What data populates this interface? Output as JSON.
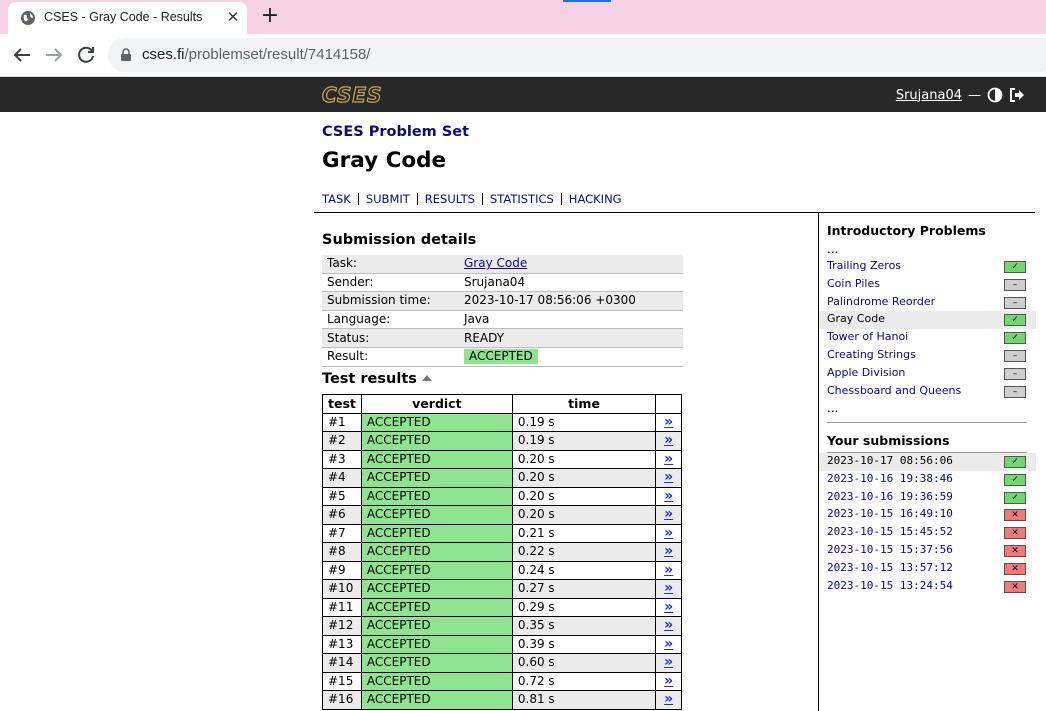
{
  "browser": {
    "tab_title": "CSES - Gray Code - Results",
    "url_host": "cses.fi",
    "url_path": "/problemset/result/7414158/"
  },
  "header": {
    "logo": "CSES",
    "username": "Srujana04",
    "dash": "—"
  },
  "page": {
    "problemset": "CSES Problem Set",
    "title": "Gray Code",
    "nav": [
      "TASK",
      "SUBMIT",
      "RESULTS",
      "STATISTICS",
      "HACKING"
    ]
  },
  "details": {
    "heading": "Submission details",
    "rows": [
      {
        "label": "Task:",
        "value": "Gray Code"
      },
      {
        "label": "Sender:",
        "value": "Srujana04"
      },
      {
        "label": "Submission time:",
        "value": "2023-10-17 08:56:06 +0300"
      },
      {
        "label": "Language:",
        "value": "Java"
      },
      {
        "label": "Status:",
        "value": "READY"
      },
      {
        "label": "Result:",
        "value": "ACCEPTED"
      }
    ]
  },
  "tests": {
    "heading": "Test results",
    "columns": [
      "test",
      "verdict",
      "time"
    ],
    "link_glyph": "»",
    "rows": [
      {
        "test": "#1",
        "verdict": "ACCEPTED",
        "time": "0.19 s"
      },
      {
        "test": "#2",
        "verdict": "ACCEPTED",
        "time": "0.19 s"
      },
      {
        "test": "#3",
        "verdict": "ACCEPTED",
        "time": "0.20 s"
      },
      {
        "test": "#4",
        "verdict": "ACCEPTED",
        "time": "0.20 s"
      },
      {
        "test": "#5",
        "verdict": "ACCEPTED",
        "time": "0.20 s"
      },
      {
        "test": "#6",
        "verdict": "ACCEPTED",
        "time": "0.20 s"
      },
      {
        "test": "#7",
        "verdict": "ACCEPTED",
        "time": "0.21 s"
      },
      {
        "test": "#8",
        "verdict": "ACCEPTED",
        "time": "0.22 s"
      },
      {
        "test": "#9",
        "verdict": "ACCEPTED",
        "time": "0.24 s"
      },
      {
        "test": "#10",
        "verdict": "ACCEPTED",
        "time": "0.27 s"
      },
      {
        "test": "#11",
        "verdict": "ACCEPTED",
        "time": "0.29 s"
      },
      {
        "test": "#12",
        "verdict": "ACCEPTED",
        "time": "0.35 s"
      },
      {
        "test": "#13",
        "verdict": "ACCEPTED",
        "time": "0.39 s"
      },
      {
        "test": "#14",
        "verdict": "ACCEPTED",
        "time": "0.60 s"
      },
      {
        "test": "#15",
        "verdict": "ACCEPTED",
        "time": "0.72 s"
      },
      {
        "test": "#16",
        "verdict": "ACCEPTED",
        "time": "0.81 s"
      }
    ]
  },
  "sidebar": {
    "section_title": "Introductory Problems",
    "ellipsis": "...",
    "problems": [
      {
        "name": "Trailing Zeros",
        "status": "ok",
        "selected": false
      },
      {
        "name": "Coin Piles",
        "status": "none",
        "selected": false
      },
      {
        "name": "Palindrome Reorder",
        "status": "none",
        "selected": false
      },
      {
        "name": "Gray Code",
        "status": "ok",
        "selected": true
      },
      {
        "name": "Tower of Hanoi",
        "status": "ok",
        "selected": false
      },
      {
        "name": "Creating Strings",
        "status": "none",
        "selected": false
      },
      {
        "name": "Apple Division",
        "status": "none",
        "selected": false
      },
      {
        "name": "Chessboard and Queens",
        "status": "none",
        "selected": false
      }
    ],
    "submissions_title": "Your submissions",
    "submissions": [
      {
        "time": "2023-10-17 08:56:06",
        "status": "ok",
        "selected": true
      },
      {
        "time": "2023-10-16 19:38:46",
        "status": "ok",
        "selected": false
      },
      {
        "time": "2023-10-16 19:36:59",
        "status": "ok",
        "selected": false
      },
      {
        "time": "2023-10-15 16:49:10",
        "status": "bad",
        "selected": false
      },
      {
        "time": "2023-10-15 15:45:52",
        "status": "bad",
        "selected": false
      },
      {
        "time": "2023-10-15 15:37:56",
        "status": "bad",
        "selected": false
      },
      {
        "time": "2023-10-15 13:57:12",
        "status": "bad",
        "selected": false
      },
      {
        "time": "2023-10-15 13:24:54",
        "status": "bad",
        "selected": false
      }
    ],
    "badge_glyphs": {
      "ok": "✓",
      "none": "–",
      "bad": "✕"
    }
  },
  "colors": {
    "accepted": "#8fe48f",
    "link": "#0b0b80",
    "header_bg": "#282828",
    "tabstrip_bg": "#f6d2e3"
  }
}
